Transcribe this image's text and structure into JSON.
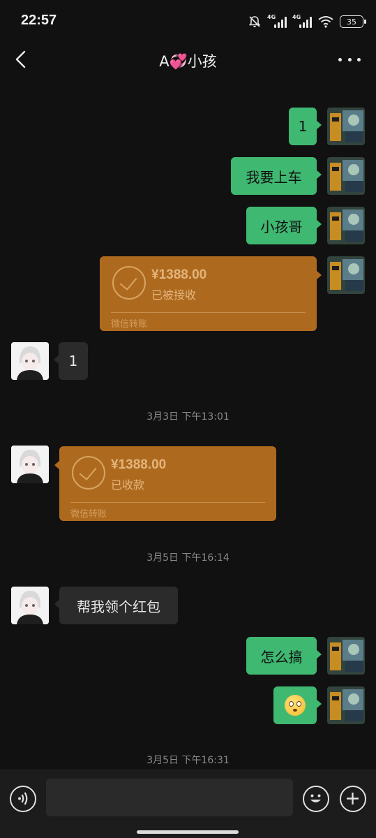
{
  "status_bar": {
    "time": "22:57",
    "network_1": "4G",
    "network_2": "4G",
    "battery": "35",
    "icons": [
      "bell-mute-icon",
      "signal-icon",
      "signal-icon",
      "wifi-icon",
      "battery-icon"
    ]
  },
  "header": {
    "title_prefix": "A",
    "title_emoji": "💞",
    "title_suffix": "小孩",
    "back_icon": "chevron-left-icon",
    "more_icon": "more-dots-icon"
  },
  "messages": {
    "m1": {
      "text": "1"
    },
    "m2": {
      "text": "我要上车"
    },
    "m3": {
      "text": "小孩哥"
    },
    "transfer1": {
      "amount": "¥1388.00",
      "status": "已被接收",
      "label": "微信转账"
    },
    "m4": {
      "text": "1"
    },
    "ts1": "3月3日 下午13:01",
    "transfer2": {
      "amount": "¥1388.00",
      "status": "已收款",
      "label": "微信转账"
    },
    "ts2": "3月5日 下午16:14",
    "m5": {
      "text": "帮我领个红包"
    },
    "m6": {
      "text": "怎么搞"
    },
    "m7": {
      "emoji": "flushed-face-emoji"
    },
    "ts3": "3月5日 下午16:31"
  },
  "input_bar": {
    "voice_icon": "voice-icon",
    "emoji_icon": "smiley-icon",
    "plus_icon": "plus-icon"
  },
  "colors": {
    "background": "#111111",
    "my_bubble": "#3fb871",
    "their_bubble": "#2b2b2b",
    "transfer_card": "#ad6a1f"
  }
}
